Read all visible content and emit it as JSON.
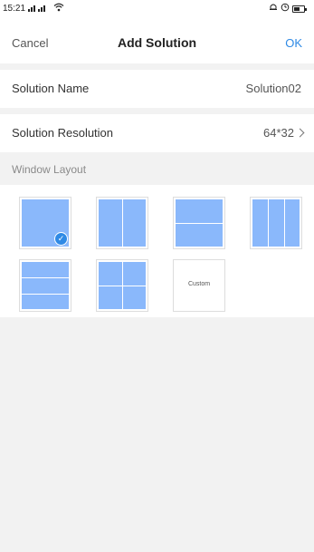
{
  "status_bar": {
    "time": "15:21",
    "signal": "ᵢ𝗶𝗹 ᵢ𝗶𝗹",
    "wifi_icon": "wifi-icon",
    "alarm_icon": "alarm-icon",
    "clock_icon": "clock-icon",
    "battery_icon": "battery-icon"
  },
  "nav": {
    "cancel": "Cancel",
    "title": "Add Solution",
    "ok": "OK"
  },
  "solution_name": {
    "label": "Solution Name",
    "value": "Solution02"
  },
  "solution_resolution": {
    "label": "Solution Resolution",
    "value": "64*32"
  },
  "window_layout": {
    "label": "Window Layout",
    "custom_label": "Custom",
    "selected_index": 0
  },
  "colors": {
    "accent": "#2f8ae5",
    "tile_fill": "#8ab8fb",
    "background": "#f2f2f2"
  }
}
